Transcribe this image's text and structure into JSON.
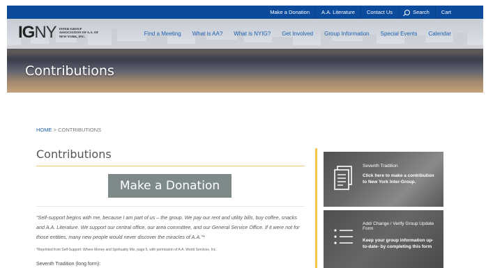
{
  "topbar": {
    "links": [
      "Make a Donation",
      "A.A. Literature",
      "Contact Us",
      "Search",
      "Cart"
    ]
  },
  "logo": {
    "mark_ig": "IG",
    "mark_ny": "NY",
    "text": "Inter-Group Association of A.A. of New York, Inc."
  },
  "nav": {
    "items": [
      "Find a Meeting",
      "What is AA?",
      "What is NYIG?",
      "Get Involved",
      "Group Information",
      "Special Events",
      "Calendar"
    ]
  },
  "banner": {
    "title": "Contributions"
  },
  "breadcrumb": {
    "home": "HOME",
    "separator": ">",
    "current": "CONTRIBUTIONS"
  },
  "main": {
    "title": "Contributions",
    "donate_label": "Make a Donation",
    "quote": "\"Self-support begins with me, because I am part of us – the group. We pay our rent and utility bills, buy coffee, snacks and A.A. Literature. We support our central office, our area committee, and our General Service Office. If it were not for those entities, many new people would never discover the miracles of A.A.\"*",
    "footnote": "*Reprinted from Self-Support: Where Money and Spirituality Mix, page 5, with permission of A.A. World Services, Inc.",
    "seventh_tradition": "Seventh Tradition (long form):"
  },
  "sidebar": {
    "cards": [
      {
        "heading": "Seventh Tradition",
        "desc": "Click here to make a contribution to New York Inter-Group.",
        "icon": "document-icon"
      },
      {
        "heading": "Add/ Change / Verify Group Update Form",
        "desc": "Keep your group information up-to-date- by completing this form",
        "icon": "list-icon"
      }
    ]
  },
  "colors": {
    "topbar": "#0c4a9c",
    "nav_link": "#1f5fae",
    "accent": "#f3c548",
    "donate_button": "#7e8a8a"
  }
}
